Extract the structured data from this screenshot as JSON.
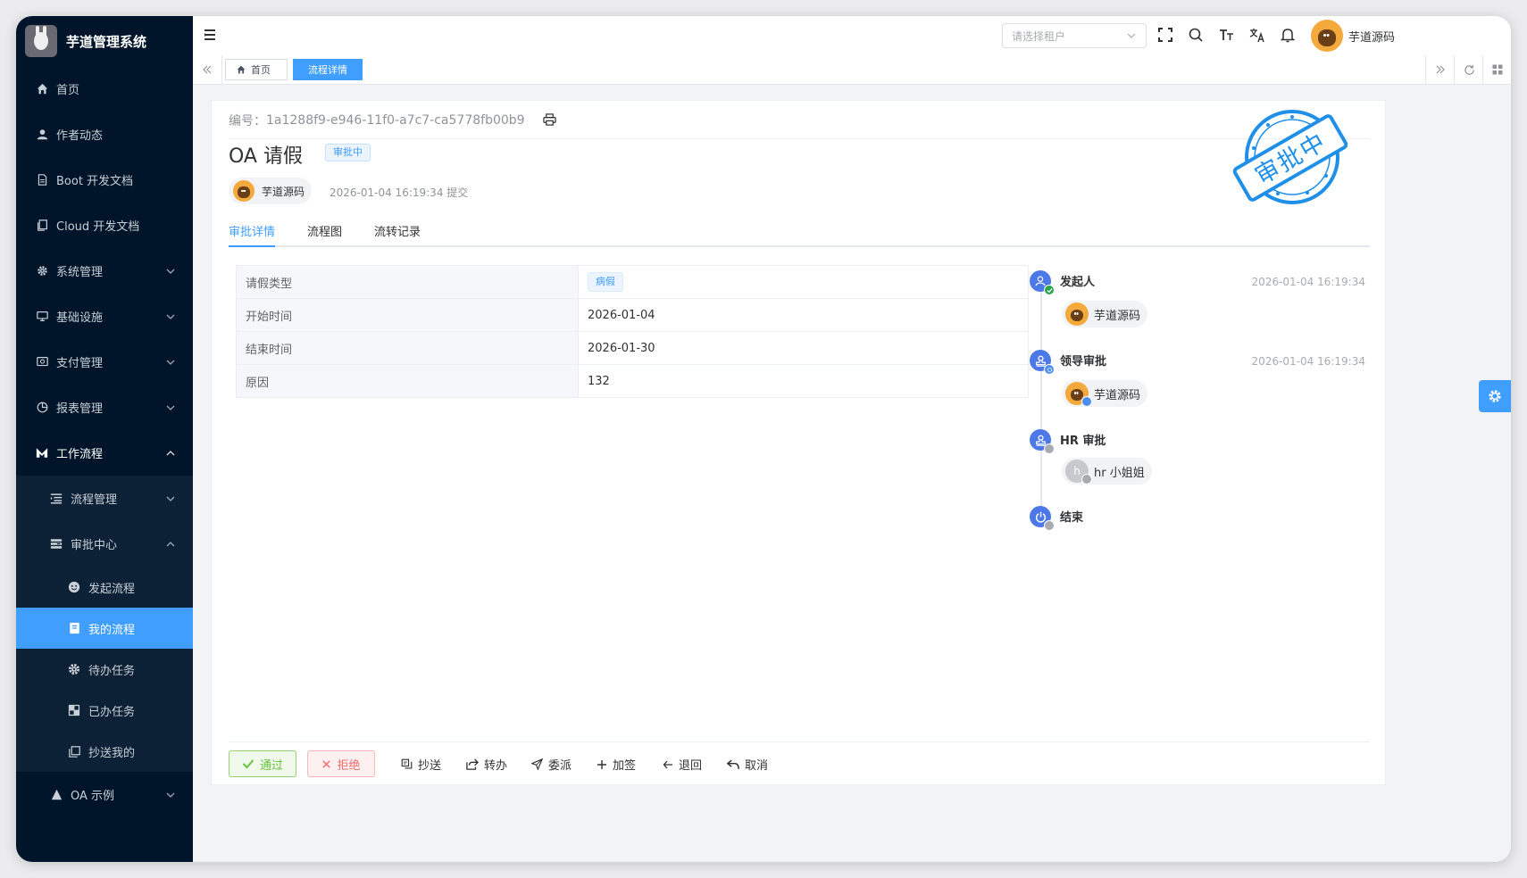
{
  "app": {
    "title": "芋道管理系统"
  },
  "sidebar": {
    "items": [
      {
        "label": "首页",
        "icon": "home-icon"
      },
      {
        "label": "作者动态",
        "icon": "user-icon"
      },
      {
        "label": "Boot 开发文档",
        "icon": "document-icon"
      },
      {
        "label": "Cloud 开发文档",
        "icon": "document-icon"
      },
      {
        "label": "系统管理",
        "icon": "gear-icon"
      },
      {
        "label": "基础设施",
        "icon": "monitor-icon"
      },
      {
        "label": "支付管理",
        "icon": "payment-icon"
      },
      {
        "label": "报表管理",
        "icon": "pie-chart-icon"
      },
      {
        "label": "工作流程",
        "icon": "workflow-icon"
      },
      {
        "label": "流程管理",
        "icon": "list-icon"
      },
      {
        "label": "审批中心",
        "icon": "approval-icon"
      },
      {
        "label": "发起流程",
        "icon": "smile-icon"
      },
      {
        "label": "我的流程",
        "icon": "book-icon"
      },
      {
        "label": "待办任务",
        "icon": "cog-icon"
      },
      {
        "label": "已办任务",
        "icon": "squares-icon"
      },
      {
        "label": "抄送我的",
        "icon": "copy-icon"
      },
      {
        "label": "OA 示例",
        "icon": "oa-icon"
      }
    ]
  },
  "navbar": {
    "tenant_placeholder": "请选择租户",
    "user_name": "芋道源码"
  },
  "tags": {
    "home": "首页",
    "current": "流程详情"
  },
  "process": {
    "number_label": "编号：",
    "number": "1a1288f9-e946-11f0-a7c7-ca5778fb00b9",
    "title": "OA 请假",
    "status": "审批中",
    "starter": "芋道源码",
    "submit_time": "2026-01-04 16:19:34",
    "submit_suffix": "提交",
    "stamp_text": "审批中"
  },
  "tabs": [
    "审批详情",
    "流程图",
    "流转记录"
  ],
  "form": {
    "rows": [
      {
        "label": "请假类型",
        "value": "病假",
        "is_tag": true
      },
      {
        "label": "开始时间",
        "value": "2026-01-04"
      },
      {
        "label": "结束时间",
        "value": "2026-01-30"
      },
      {
        "label": "原因",
        "value": "132"
      }
    ]
  },
  "timeline": [
    {
      "title": "发起人",
      "time": "2026-01-04 16:19:34",
      "user": "芋道源码",
      "status": "completed"
    },
    {
      "title": "领导审批",
      "time": "2026-01-04 16:19:34",
      "user": "芋道源码",
      "status": "running"
    },
    {
      "title": "HR 审批",
      "time": "",
      "user": "hr 小姐姐",
      "user_initial": "h",
      "status": "pending"
    },
    {
      "title": "结束",
      "time": "",
      "user": "",
      "status": "pending"
    }
  ],
  "actions": {
    "approve": "通过",
    "reject": "拒绝",
    "copy": "抄送",
    "transfer": "转办",
    "delegate": "委派",
    "add_sign": "加签",
    "return": "退回",
    "cancel": "取消"
  },
  "colors": {
    "primary": "#409eff",
    "sidebar": "#001529",
    "success": "#67c23a",
    "danger": "#f56c6c",
    "node": "#4c78e8"
  }
}
